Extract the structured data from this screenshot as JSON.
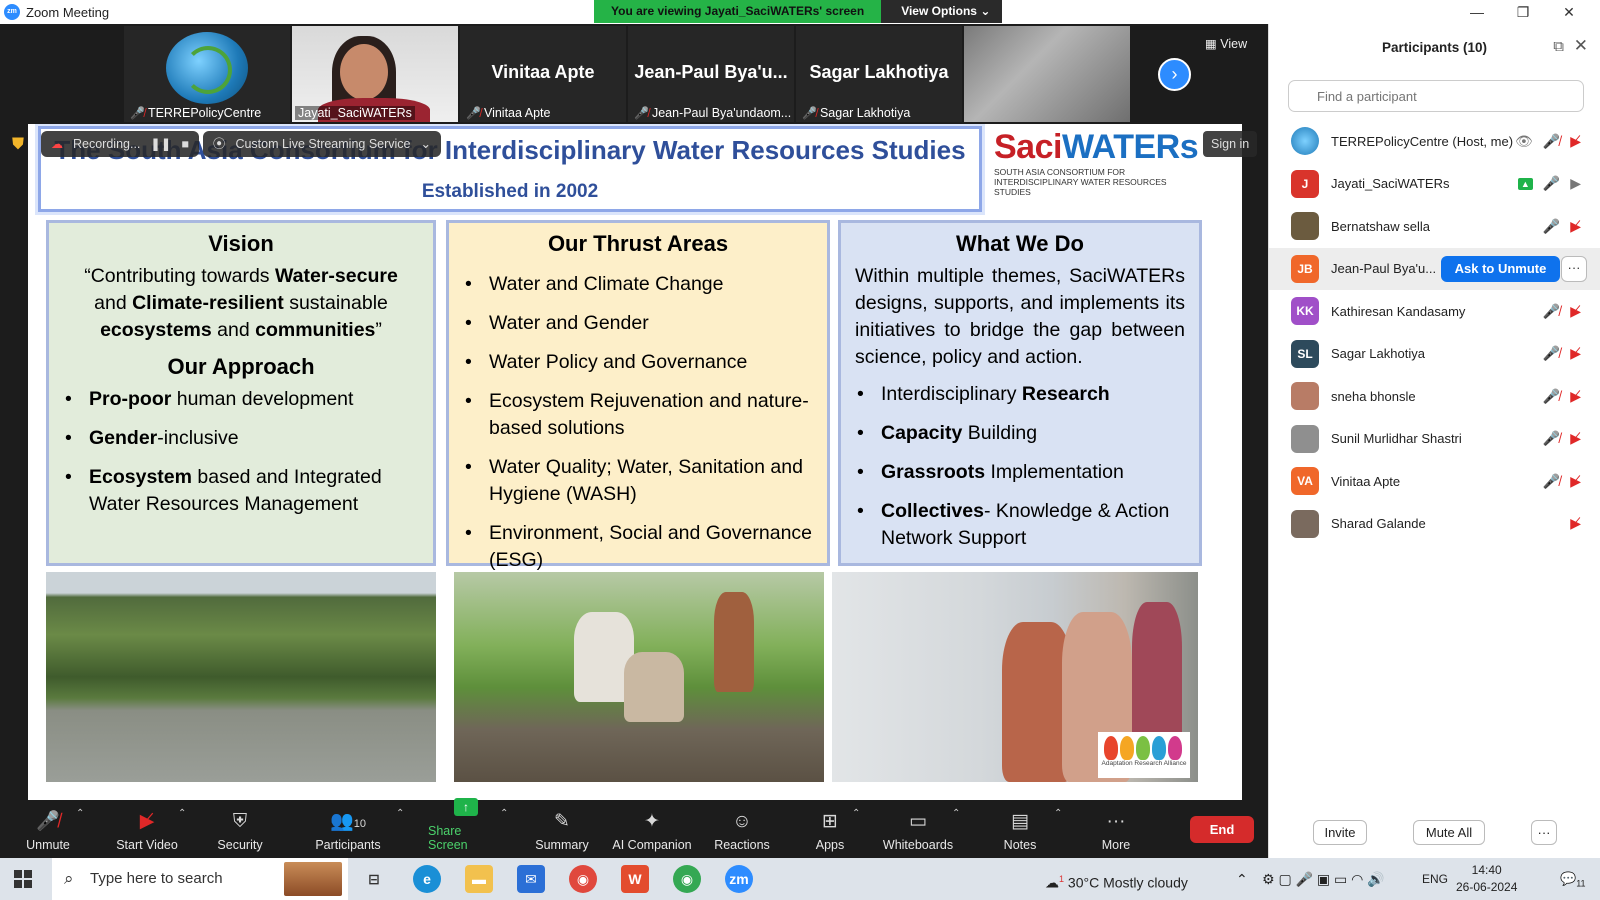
{
  "window": {
    "title": "Zoom Meeting",
    "app_icon": "zoom-icon",
    "viewing_banner": "You are viewing Jayati_SaciWATERs' screen",
    "view_options": "View Options"
  },
  "thumbnails": [
    {
      "label": "TERREPolicyCentre",
      "display": "",
      "muted": true,
      "type": "logo"
    },
    {
      "label": "Jayati_SaciWATERs",
      "display": "",
      "muted": false,
      "type": "video"
    },
    {
      "label": "Vinitaa Apte",
      "display": "Vinitaa Apte",
      "muted": true,
      "type": "name"
    },
    {
      "label": "Jean-Paul Bya'undaom...",
      "display": "Jean-Paul Bya'u...",
      "muted": true,
      "type": "name"
    },
    {
      "label": "Sagar Lakhotiya",
      "display": "Sagar Lakhotiya",
      "muted": true,
      "type": "name"
    }
  ],
  "view_button": "View",
  "recording": {
    "label": "Recording...",
    "streaming": "Custom Live Streaming Service",
    "sign_in": "Sign in"
  },
  "slide": {
    "title": "The South Asia Consortium for Interdisciplinary Water Resources Studies",
    "subtitle": "Established in 2002",
    "logo_brand_a": "Saci",
    "logo_brand_b": "WATERs",
    "logo_tagline_1": "SOUTH ASIA CONSORTIUM FOR",
    "logo_tagline_2": "INTERDISCIPLINARY WATER RESOURCES STUDIES",
    "vision": {
      "heading": "Vision",
      "quote_1": "“Contributing towards ",
      "quote_b1": "Water-secure",
      "quote_2": " and ",
      "quote_b2": "Climate-resilient",
      "quote_3": " sustainable ",
      "quote_b3": "ecosystems",
      "quote_4": " and ",
      "quote_b4": "communities",
      "quote_5": "”",
      "approach_heading": "Our Approach",
      "items": [
        {
          "bold": "Pro-poor",
          "rest": " human development"
        },
        {
          "bold": "Gender",
          "rest": "-inclusive"
        },
        {
          "bold": "Ecosystem",
          "rest": " based and Integrated Water Resources Management"
        }
      ]
    },
    "thrust": {
      "heading": "Our Thrust Areas",
      "items": [
        "Water and Climate Change",
        "Water and Gender",
        "Water Policy and Governance",
        "Ecosystem Rejuvenation and nature-based solutions",
        "Water Quality; Water, Sanitation and Hygiene (WASH)",
        "Environment, Social and Governance (ESG)"
      ]
    },
    "whatwedo": {
      "heading": "What We Do",
      "intro": "Within multiple themes, SaciWATERs designs, supports, and implements its initiatives to bridge the gap between science, policy and action.",
      "items": [
        {
          "pre": "Interdisciplinary ",
          "bold": "Research",
          "post": ""
        },
        {
          "pre": "",
          "bold": "Capacity",
          "post": " Building"
        },
        {
          "pre": "",
          "bold": "Grassroots",
          "post": " Implementation"
        },
        {
          "pre": "",
          "bold": "Collectives",
          "post": "- Knowledge & Action Network Support"
        }
      ]
    },
    "ara_logo_text": "Adaptation Research Alliance"
  },
  "toolbar": {
    "unmute": "Unmute",
    "start_video": "Start Video",
    "security": "Security",
    "participants": "Participants",
    "participants_count": "10",
    "share_screen": "Share Screen",
    "summary": "Summary",
    "ai_companion": "AI Companion",
    "reactions": "Reactions",
    "apps": "Apps",
    "whiteboards": "Whiteboards",
    "notes": "Notes",
    "more": "More",
    "end": "End"
  },
  "panel": {
    "title": "Participants (10)",
    "search_placeholder": "Find a participant",
    "ask_to_unmute": "Ask to Unmute",
    "more": "···",
    "participants": [
      {
        "name": "TERREPolicyCentre (Host, me)",
        "initials": "",
        "color": "#3a8fd0",
        "mic": "muted",
        "video": "off",
        "extra": "eye"
      },
      {
        "name": "Jayati_SaciWATERs",
        "initials": "J",
        "color": "#d9342b",
        "mic": "on",
        "video": "on",
        "extra": "share"
      },
      {
        "name": "Bernatshaw sella",
        "initials": "",
        "color": "#6b5b3f",
        "mic": "on",
        "video": "off",
        "extra": ""
      },
      {
        "name": "Jean-Paul Bya'u...",
        "initials": "JB",
        "color": "#f0672a",
        "mic": "",
        "video": "",
        "extra": "ask"
      },
      {
        "name": "Kathiresan Kandasamy",
        "initials": "KK",
        "color": "#a04fc8",
        "mic": "muted",
        "video": "off",
        "extra": ""
      },
      {
        "name": "Sagar Lakhotiya",
        "initials": "SL",
        "color": "#2d4a5c",
        "mic": "muted",
        "video": "off",
        "extra": ""
      },
      {
        "name": "sneha bhonsle",
        "initials": "",
        "color": "#b87c66",
        "mic": "muted",
        "video": "off",
        "extra": ""
      },
      {
        "name": "Sunil Murlidhar Shastri",
        "initials": "",
        "color": "#8f8f8f",
        "mic": "muted",
        "video": "off",
        "extra": ""
      },
      {
        "name": "Vinitaa Apte",
        "initials": "VA",
        "color": "#f0672a",
        "mic": "muted",
        "video": "off",
        "extra": ""
      },
      {
        "name": "Sharad Galande",
        "initials": "",
        "color": "#7a6a5e",
        "mic": "",
        "video": "off",
        "extra": ""
      }
    ],
    "invite": "Invite",
    "mute_all": "Mute All",
    "more_bottom": "···"
  },
  "taskbar": {
    "search_placeholder": "Type here to search",
    "weather": "30°C  Mostly cloudy",
    "weather_badge": "1",
    "lang": "ENG",
    "time": "14:40",
    "date": "26-06-2024",
    "notifications": "11"
  },
  "colors": {
    "accent": "#0e72ed",
    "end_red": "#d52b2b",
    "share_green": "#1fb34a",
    "slide_blue": "#2f4f9a"
  }
}
